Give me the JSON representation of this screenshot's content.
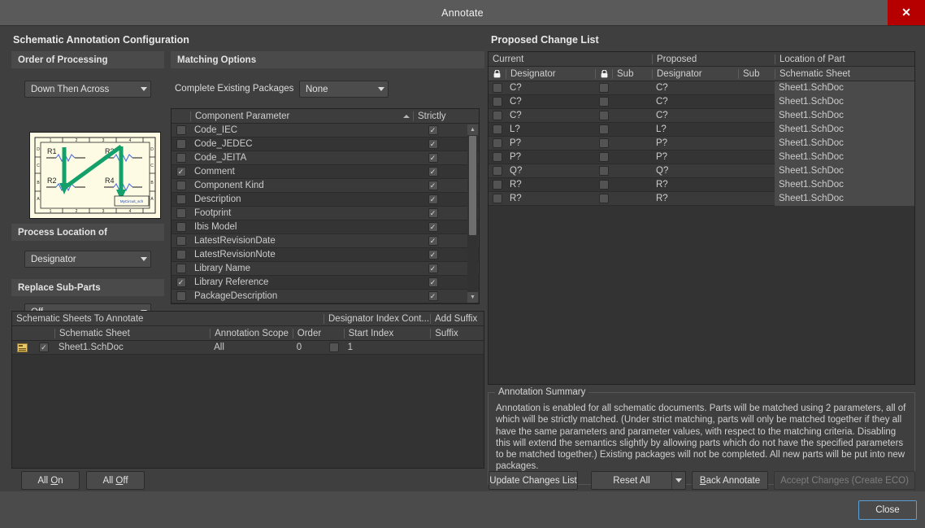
{
  "window": {
    "title": "Annotate",
    "close_icon": "close-icon"
  },
  "left": {
    "title": "Schematic Annotation Configuration",
    "order_of_processing": {
      "header": "Order of Processing",
      "value": "Down Then Across"
    },
    "preview": {
      "labels": [
        "R1",
        "R3",
        "R2",
        "R4"
      ],
      "corner_label": "MyCircuit_sch",
      "col_ticks": [
        "1",
        "2",
        "3",
        "4"
      ],
      "row_ticks": [
        "D",
        "C",
        "B",
        "A"
      ]
    },
    "process_location_of": {
      "header": "Process Location of",
      "value": "Designator"
    },
    "replace_sub_parts": {
      "header": "Replace Sub-Parts",
      "value": "Off"
    },
    "matching_options": {
      "header": "Matching Options",
      "complete_existing_packages_label": "Complete Existing Packages",
      "complete_existing_packages_value": "None",
      "columns": [
        "",
        "Component Parameter",
        "Strictly"
      ],
      "sort_indicator": "ascending-sort-icon",
      "rows": [
        {
          "checked": false,
          "name": "Code_IEC",
          "strictly": true
        },
        {
          "checked": false,
          "name": "Code_JEDEC",
          "strictly": true
        },
        {
          "checked": false,
          "name": "Code_JEITA",
          "strictly": true
        },
        {
          "checked": true,
          "name": "Comment",
          "strictly": true
        },
        {
          "checked": false,
          "name": "Component Kind",
          "strictly": true
        },
        {
          "checked": false,
          "name": "Description",
          "strictly": true
        },
        {
          "checked": false,
          "name": "Footprint",
          "strictly": true
        },
        {
          "checked": false,
          "name": "Ibis Model",
          "strictly": true
        },
        {
          "checked": false,
          "name": "LatestRevisionDate",
          "strictly": true
        },
        {
          "checked": false,
          "name": "LatestRevisionNote",
          "strictly": true
        },
        {
          "checked": false,
          "name": "Library Name",
          "strictly": true
        },
        {
          "checked": true,
          "name": "Library Reference",
          "strictly": true
        },
        {
          "checked": false,
          "name": "PackageDescription",
          "strictly": true
        }
      ]
    },
    "sheets": {
      "group_headers": [
        "Schematic Sheets To Annotate",
        "Designator Index Cont...",
        "Add Suffix"
      ],
      "columns": [
        "",
        "",
        "Schematic Sheet",
        "Annotation Scope",
        "Order",
        "",
        "Start Index",
        "Suffix"
      ],
      "rows": [
        {
          "doc_icon": "schematic-document-icon",
          "enabled": true,
          "sheet": "Sheet1.SchDoc",
          "scope": "All",
          "order": "0",
          "index_control": false,
          "start_index": "1",
          "suffix": ""
        }
      ]
    },
    "buttons": {
      "all_on": "All On",
      "all_on_key": "O",
      "all_off": "All Off",
      "all_off_key": "O"
    }
  },
  "right": {
    "title": "Proposed Change List",
    "group_headers": [
      "Current",
      "Proposed",
      "Location of Part"
    ],
    "columns": [
      "lock-icon",
      "Designator",
      "lock-icon",
      "Sub",
      "Designator",
      "Sub",
      "Schematic Sheet"
    ],
    "rows": [
      {
        "cur_lock": false,
        "cur_designator": "C?",
        "cur_sub_lock": false,
        "cur_sub": "",
        "prop_designator": "C?",
        "prop_sub": "",
        "location": "Sheet1.SchDoc"
      },
      {
        "cur_lock": false,
        "cur_designator": "C?",
        "cur_sub_lock": false,
        "cur_sub": "",
        "prop_designator": "C?",
        "prop_sub": "",
        "location": "Sheet1.SchDoc"
      },
      {
        "cur_lock": false,
        "cur_designator": "C?",
        "cur_sub_lock": false,
        "cur_sub": "",
        "prop_designator": "C?",
        "prop_sub": "",
        "location": "Sheet1.SchDoc"
      },
      {
        "cur_lock": false,
        "cur_designator": "L?",
        "cur_sub_lock": false,
        "cur_sub": "",
        "prop_designator": "L?",
        "prop_sub": "",
        "location": "Sheet1.SchDoc"
      },
      {
        "cur_lock": false,
        "cur_designator": "P?",
        "cur_sub_lock": false,
        "cur_sub": "",
        "prop_designator": "P?",
        "prop_sub": "",
        "location": "Sheet1.SchDoc"
      },
      {
        "cur_lock": false,
        "cur_designator": "P?",
        "cur_sub_lock": false,
        "cur_sub": "",
        "prop_designator": "P?",
        "prop_sub": "",
        "location": "Sheet1.SchDoc"
      },
      {
        "cur_lock": false,
        "cur_designator": "Q?",
        "cur_sub_lock": false,
        "cur_sub": "",
        "prop_designator": "Q?",
        "prop_sub": "",
        "location": "Sheet1.SchDoc"
      },
      {
        "cur_lock": false,
        "cur_designator": "R?",
        "cur_sub_lock": false,
        "cur_sub": "",
        "prop_designator": "R?",
        "prop_sub": "",
        "location": "Sheet1.SchDoc"
      },
      {
        "cur_lock": false,
        "cur_designator": "R?",
        "cur_sub_lock": false,
        "cur_sub": "",
        "prop_designator": "R?",
        "prop_sub": "",
        "location": "Sheet1.SchDoc"
      }
    ],
    "summary": {
      "title": "Annotation Summary",
      "text": "Annotation is enabled for all schematic documents. Parts will be matched using 2 parameters, all of which will be strictly matched. (Under strict matching, parts will only be matched together if they all have the same parameters and parameter values, with respect to the matching criteria. Disabling this will extend the semantics slightly by allowing parts which do not have the specified parameters to be matched together.) Existing packages will not be completed. All new parts will be put into new packages."
    },
    "buttons": {
      "update": "Update Changes List",
      "reset": "Reset All",
      "back_annotate": "Back Annotate",
      "back_annotate_key": "B",
      "accept": "Accept Changes (Create ECO)"
    }
  },
  "footer": {
    "close": "Close"
  },
  "colors": {
    "accent_red": "#b60000",
    "focus_blue": "#5c9fd6",
    "preview_paper": "#fdfbe4",
    "preview_arrow": "#13a06a"
  }
}
